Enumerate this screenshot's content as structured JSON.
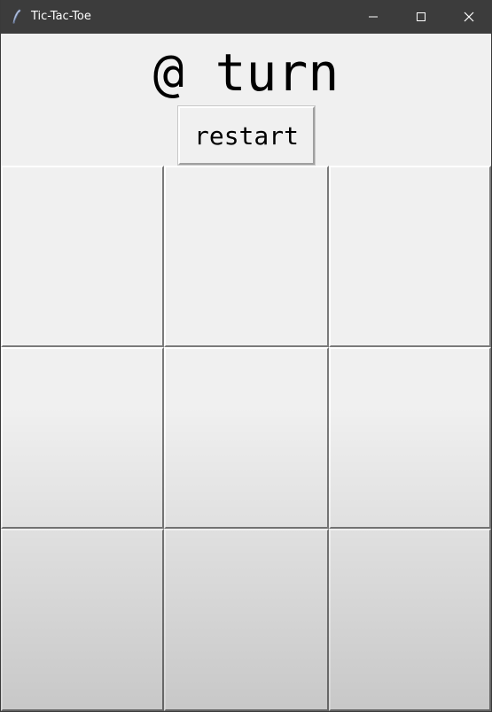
{
  "window": {
    "title": "Tic-Tac-Toe",
    "titlebar_color": "#3c3c3c",
    "controls": [
      "minimize-icon",
      "maximize-icon",
      "close-icon"
    ]
  },
  "game": {
    "turn_text": "@ turn",
    "restart_label": "restart",
    "board": [
      [
        "",
        "",
        ""
      ],
      [
        "",
        "",
        ""
      ],
      [
        "",
        "",
        ""
      ]
    ]
  }
}
